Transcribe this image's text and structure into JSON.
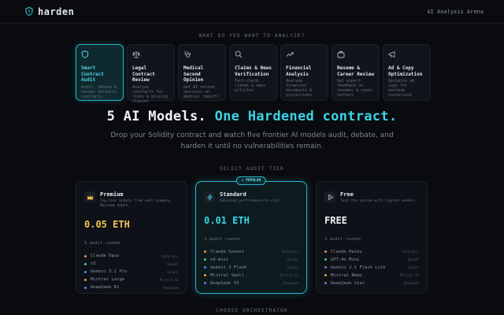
{
  "header": {
    "brand": "harden",
    "right_label": "AI Analysis Arena"
  },
  "analyze_label": "WHAT DO YOU WANT TO ANALYZE?",
  "categories": [
    {
      "title": "Smart Contract Audit",
      "desc": "Audit, debate & harden Solidity contracts",
      "icon": "shield-icon",
      "active": true
    },
    {
      "title": "Legal Contract Review",
      "desc": "Analyze contracts for risks & missing clauses",
      "icon": "scale-icon",
      "active": false
    },
    {
      "title": "Medical Second Opinion",
      "desc": "Get AI second opinions on medical reports",
      "icon": "stethoscope-icon",
      "active": false
    },
    {
      "title": "Claims & News Verification",
      "desc": "Fact-check claims & news articles",
      "icon": "magnifier-icon",
      "active": false
    },
    {
      "title": "Financial Analysis",
      "desc": "Analyze financial documents & projections",
      "icon": "trend-icon",
      "active": false
    },
    {
      "title": "Resume & Career Review",
      "desc": "Get expert feedback on resumes & cover letters",
      "icon": "briefcase-icon",
      "active": false
    },
    {
      "title": "Ad & Copy Optimization",
      "desc": "Optimize ad copy for maximum conversion",
      "icon": "megaphone-icon",
      "active": false
    }
  ],
  "hero": {
    "lead": "5 AI Models.",
    "accent": "One Hardened contract."
  },
  "subtitle": "Drop your Solidity contract and watch five frontier AI models audit, debate, and harden it until no vulnerabilities remain.",
  "tier_label": "SELECT AUDIT TIER",
  "tiers": [
    {
      "name": "Premium",
      "desc": "Top-tier models from each company. Maximum depth.",
      "price": "0.05 ETH",
      "price_color": "#f2c14e",
      "rounds": "5 audit rounds",
      "icon": "crown-icon",
      "models": [
        {
          "name": "Claude Opus",
          "provider": "Anthropic",
          "color": "#e8935a"
        },
        {
          "name": "o3",
          "provider": "OpenAI",
          "color": "#3fcf8e"
        },
        {
          "name": "Gemini 3.1 Pro",
          "provider": "Google",
          "color": "#4b8bf5"
        },
        {
          "name": "Mistral Large",
          "provider": "Mistral AI",
          "color": "#f0a030"
        },
        {
          "name": "DeepSeek R1",
          "provider": "DeepSeek",
          "color": "#6b7cf5"
        }
      ]
    },
    {
      "name": "Standard",
      "desc": "Balanced performance-to-cost.",
      "badge": "★ POPULAR",
      "price": "0.01 ETH",
      "price_color": "#3ad4e6",
      "rounds": "3 audit rounds",
      "icon": "bolt-icon",
      "models": [
        {
          "name": "Claude Sonnet",
          "provider": "Anthropic",
          "color": "#e8935a"
        },
        {
          "name": "o4-mini",
          "provider": "OpenAI",
          "color": "#3fcf8e"
        },
        {
          "name": "Gemini 3 Flash",
          "provider": "Google",
          "color": "#4b8bf5"
        },
        {
          "name": "Mistral Small",
          "provider": "Mistral AI",
          "color": "#f0a030"
        },
        {
          "name": "DeepSeek V3",
          "provider": "DeepSeek",
          "color": "#6b7cf5"
        }
      ]
    },
    {
      "name": "Free",
      "desc": "Test the system with lighter models.",
      "price": "FREE",
      "price_color": "#f0f2f6",
      "rounds": "2 audit rounds",
      "icon": "play-icon",
      "models": [
        {
          "name": "Claude Haiku",
          "provider": "Anthropic",
          "color": "#e8935a"
        },
        {
          "name": "GPT-4o Mini",
          "provider": "OpenAI",
          "color": "#3fcf8e"
        },
        {
          "name": "Gemini 2.1 Flash Lite",
          "provider": "Google",
          "color": "#4b8bf5"
        },
        {
          "name": "Mistral Nemo",
          "provider": "Mistral AI",
          "color": "#f0a030"
        },
        {
          "name": "DeepSeek Chat",
          "provider": "DeepSeek",
          "color": "#6b7cf5"
        }
      ]
    }
  ],
  "orchestrator_label": "CHOOSE ORCHESTRATOR"
}
